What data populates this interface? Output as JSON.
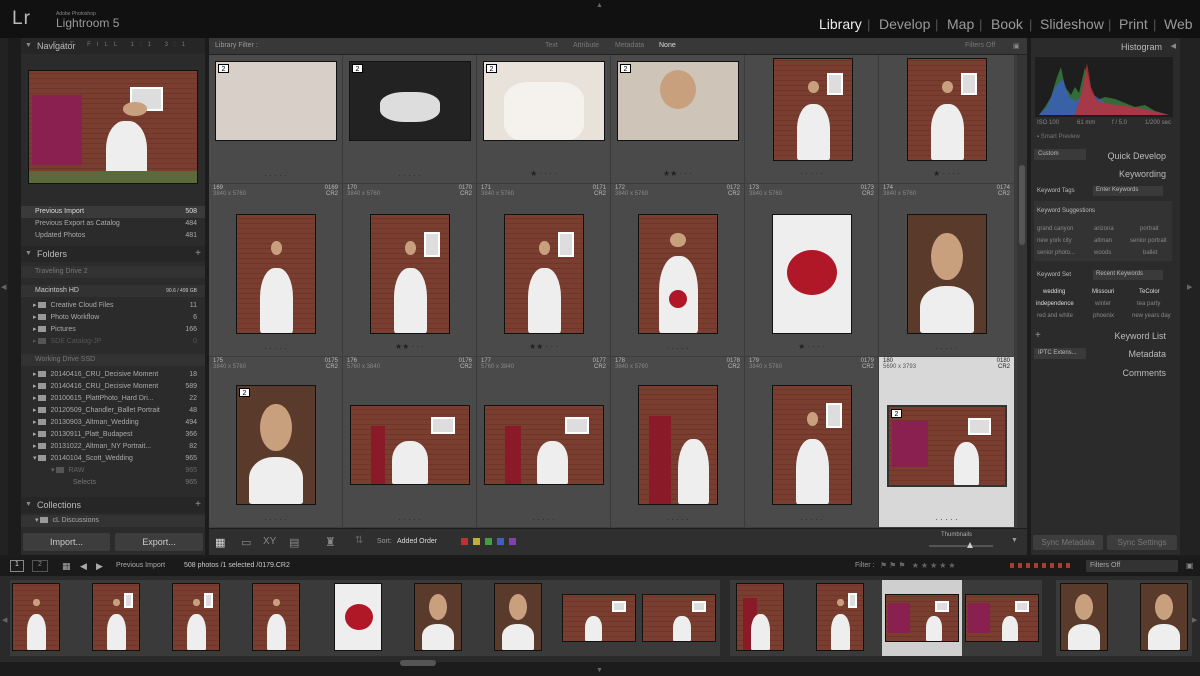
{
  "app": {
    "logo": "Lr",
    "vendor": "Adobe Photoshop",
    "name": "Lightroom 5"
  },
  "modules": [
    "Library",
    "Develop",
    "Map",
    "Book",
    "Slideshow",
    "Print",
    "Web"
  ],
  "navigator": {
    "title": "Navigator",
    "zoom": [
      "FIT",
      "FILL",
      "1:1",
      "3:1"
    ]
  },
  "catalog": [
    {
      "label": "Previous Import",
      "count": "508"
    },
    {
      "label": "Previous Export as Catalog",
      "count": "484"
    },
    {
      "label": "Updated Photos",
      "count": "481"
    }
  ],
  "folders": {
    "title": "Folders",
    "drive1": "Traveling Drive 2",
    "drive2": "Macintosh HD",
    "drive2_size": "90.6 / 499 GB",
    "items": [
      {
        "label": "Creative Cloud Files",
        "count": "11"
      },
      {
        "label": "Photo Workflow",
        "count": "6"
      },
      {
        "label": "Pictures",
        "count": "166"
      },
      {
        "label": "SDE Catalog-JP",
        "count": "0"
      }
    ],
    "drive3": "Working Drive SSD",
    "items2": [
      {
        "label": "20140416_CRU_Decisive Moment",
        "count": "18"
      },
      {
        "label": "20140416_CRU_Decisive Moment",
        "count": "589"
      },
      {
        "label": "20100615_PlattPhoto_Hard Dri...",
        "count": "22"
      },
      {
        "label": "20120509_Chandler_Ballet Portrait",
        "count": "48"
      },
      {
        "label": "20130903_Altman_Wedding",
        "count": "494"
      },
      {
        "label": "20130911_Platt_Budapest",
        "count": "366"
      },
      {
        "label": "20131022_Altman_NY Portrait...",
        "count": "82"
      },
      {
        "label": "20140104_Scott_Wedding",
        "count": "965"
      },
      {
        "label": "RAW",
        "count": "965"
      },
      {
        "label": "Selects",
        "count": "965"
      }
    ]
  },
  "collections": {
    "title": "Collections",
    "item": "cL Discussions"
  },
  "buttons": {
    "import": "Import...",
    "export": "Export...",
    "sync_meta": "Sync Metadata",
    "sync_set": "Sync Settings"
  },
  "filterbar": {
    "title": "Library Filter :",
    "text": "Text",
    "attribute": "Attribute",
    "metadata": "Metadata",
    "none": "None",
    "filters": "Filters Off"
  },
  "row2": [
    {
      "num": "169",
      "idx": "0169",
      "dim": "3840 x 5760",
      "fmt": "CR2"
    },
    {
      "num": "170",
      "idx": "0170",
      "dim": "3840 x 5760",
      "fmt": "CR2"
    },
    {
      "num": "171",
      "idx": "0171",
      "dim": "3840 x 5760",
      "fmt": "CR2"
    },
    {
      "num": "172",
      "idx": "0172",
      "dim": "3840 x 5760",
      "fmt": "CR2"
    },
    {
      "num": "173",
      "idx": "0173",
      "dim": "3840 x 5760",
      "fmt": "CR2"
    },
    {
      "num": "174",
      "idx": "0174",
      "dim": "3840 x 5760",
      "fmt": "CR2"
    }
  ],
  "row3": [
    {
      "num": "175",
      "idx": "0175",
      "dim": "3840 x 5760",
      "fmt": "CR2"
    },
    {
      "num": "176",
      "idx": "0176",
      "dim": "5760 x 3840",
      "fmt": "CR2"
    },
    {
      "num": "177",
      "idx": "0177",
      "dim": "5760 x 3840",
      "fmt": "CR2"
    },
    {
      "num": "178",
      "idx": "0178",
      "dim": "3840 x 5760",
      "fmt": "CR2"
    },
    {
      "num": "179",
      "idx": "0179",
      "dim": "3840 x 5760",
      "fmt": "CR2"
    },
    {
      "num": "180",
      "idx": "0180",
      "dim": "5690 x 3793",
      "fmt": "CR2"
    }
  ],
  "badge": "2",
  "toolbar": {
    "sort_label": "Sort:",
    "sort_value": "Added Order",
    "thumbnails": "Thumbnails"
  },
  "right": {
    "histogram": "Histogram",
    "iso": "ISO 100",
    "focal": "61 mm",
    "aperture": "f / 5.0",
    "shutter": "1/200 sec",
    "smart": "Smart Preview",
    "qd_preset": "Custom",
    "quick_develop": "Quick Develop",
    "keywording": "Keywording",
    "kw_tags": "Keyword Tags",
    "kw_enter": "Enter Keywords",
    "kw_sugg": "Keyword Suggestions",
    "sugg": [
      "grand canyon",
      "arizona",
      "portrait",
      "new york city",
      "altman",
      "senior portrait",
      "senior photo...",
      "woods",
      "ballet"
    ],
    "kw_set": "Keyword Set",
    "kw_set_val": "Recent Keywords",
    "set": [
      "wedding",
      "Missouri",
      "TeColor",
      "independence",
      "winter",
      "tea party",
      "red and white",
      "phoenix",
      "new years day"
    ],
    "keyword_list": "Keyword List",
    "metadata_preset": "IPTC Extens...",
    "metadata": "Metadata",
    "comments": "Comments"
  },
  "filmstrip": {
    "source": "Previous Import",
    "count": "508 photos /1 selected /0179.CR2",
    "filter": "Filter :",
    "filters_off": "Filters Off",
    "pages": [
      "1",
      "2"
    ]
  }
}
